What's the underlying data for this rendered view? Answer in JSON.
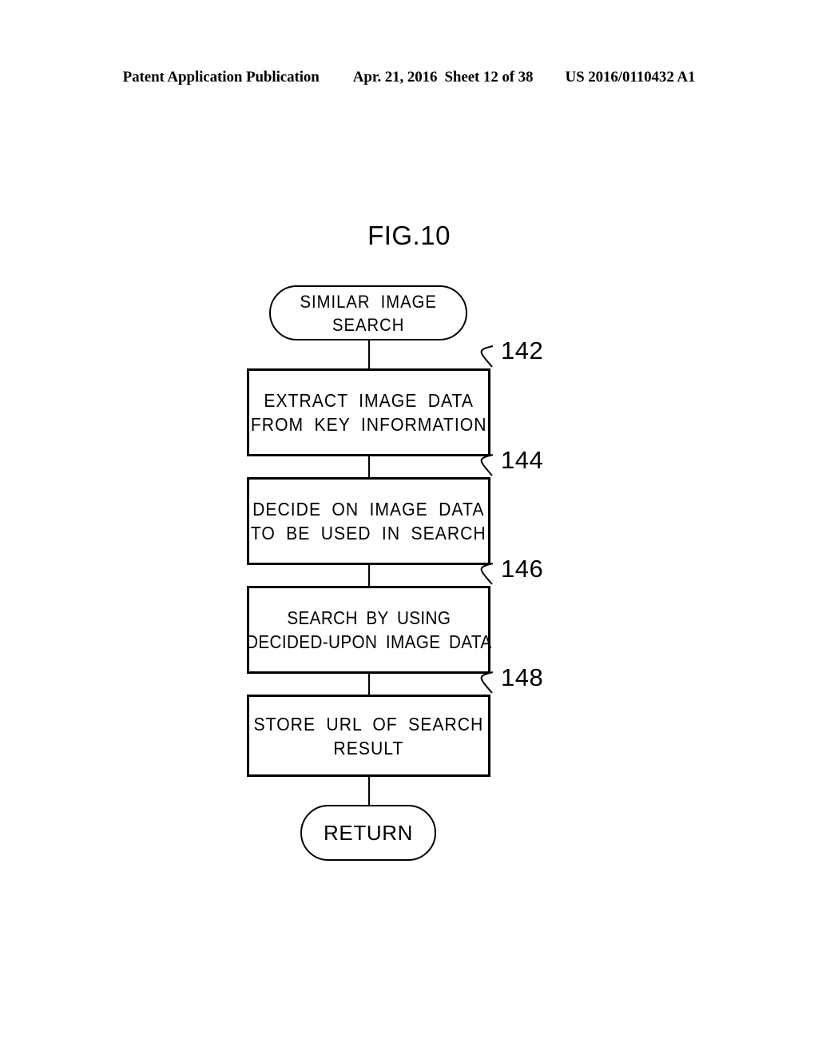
{
  "header": {
    "publication": "Patent Application Publication",
    "date": "Apr. 21, 2016",
    "sheet": "Sheet 12 of 38",
    "number": "US 2016/0110432 A1"
  },
  "figure": {
    "title": "FIG.10",
    "nodes": [
      {
        "id": "start",
        "shape": "terminal",
        "text": "SIMILAR IMAGE\nSEARCH"
      },
      {
        "id": "142",
        "shape": "process",
        "ref": "142",
        "text": "EXTRACT IMAGE DATA\nFROM KEY INFORMATION"
      },
      {
        "id": "144",
        "shape": "process",
        "ref": "144",
        "text": "DECIDE ON IMAGE DATA\nTO BE USED IN SEARCH"
      },
      {
        "id": "146",
        "shape": "process",
        "ref": "146",
        "text": "SEARCH BY USING\nDECIDED-UPON IMAGE DATA"
      },
      {
        "id": "148",
        "shape": "process",
        "ref": "148",
        "text": "STORE URL OF SEARCH\nRESULT"
      },
      {
        "id": "end",
        "shape": "terminal",
        "text": "RETURN"
      }
    ]
  },
  "colors": {
    "ink": "#000000",
    "paper": "#ffffff"
  }
}
